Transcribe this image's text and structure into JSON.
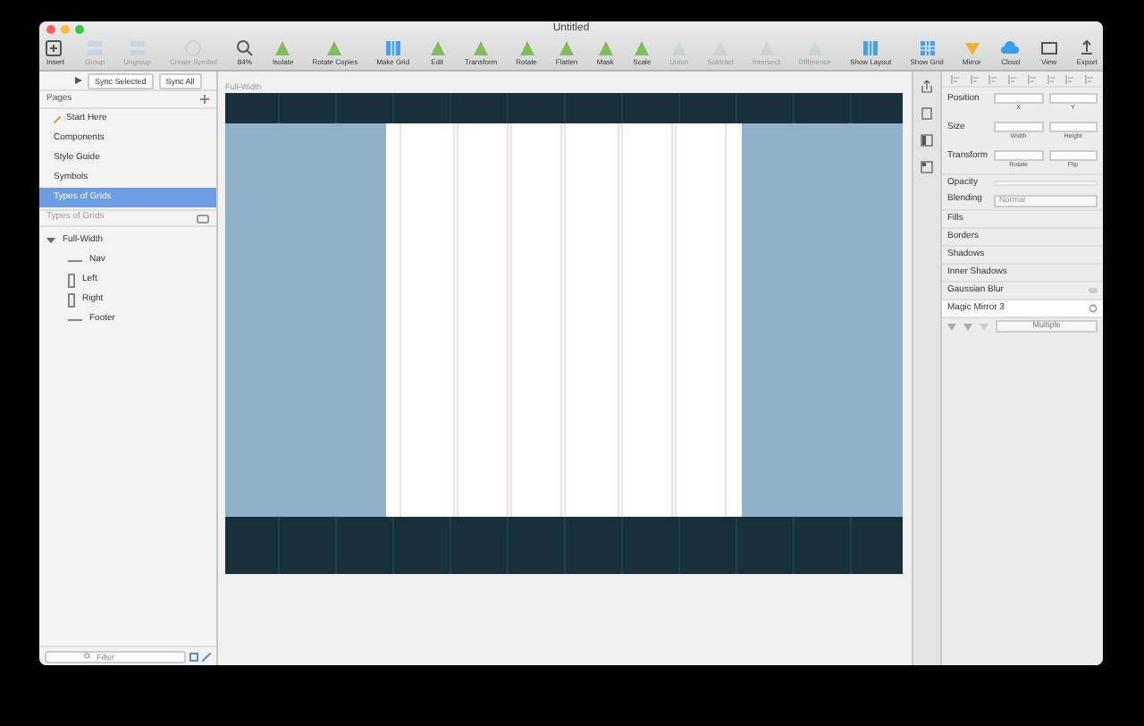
{
  "window": {
    "title": "Untitled"
  },
  "toolbar": [
    {
      "label": "Insert",
      "kind": "plus",
      "disabled": false
    },
    {
      "label": "Group",
      "kind": "group",
      "disabled": true
    },
    {
      "label": "Ungroup",
      "kind": "group",
      "disabled": true
    },
    {
      "label": "Create Symbol",
      "kind": "symbol",
      "disabled": true
    },
    {
      "label": "84%",
      "kind": "zoom",
      "disabled": false
    },
    {
      "label": "Isolate",
      "kind": "tool",
      "disabled": false
    },
    {
      "label": "Rotate Copies",
      "kind": "tool",
      "disabled": false
    },
    {
      "label": "Make Grid",
      "kind": "layout",
      "disabled": false
    },
    {
      "label": "Edit",
      "kind": "tool",
      "disabled": false
    },
    {
      "label": "Transform",
      "kind": "tool",
      "disabled": false
    },
    {
      "label": "Rotate",
      "kind": "tool",
      "disabled": false
    },
    {
      "label": "Flatten",
      "kind": "tool",
      "disabled": false
    },
    {
      "label": "Mask",
      "kind": "tool",
      "disabled": false
    },
    {
      "label": "Scale",
      "kind": "tool",
      "disabled": false
    },
    {
      "label": "Union",
      "kind": "tool",
      "disabled": true
    },
    {
      "label": "Subtract",
      "kind": "tool",
      "disabled": true
    },
    {
      "label": "Intersect",
      "kind": "tool",
      "disabled": true
    },
    {
      "label": "Difference",
      "kind": "tool",
      "disabled": true
    },
    {
      "label": "Show Layout",
      "kind": "layout",
      "disabled": false
    },
    {
      "label": "Show Grid",
      "kind": "grid",
      "disabled": false
    },
    {
      "label": "Mirror",
      "kind": "mirror",
      "disabled": false
    },
    {
      "label": "Cloud",
      "kind": "cloud",
      "disabled": false
    },
    {
      "label": "View",
      "kind": "view",
      "disabled": false
    },
    {
      "label": "Export",
      "kind": "export",
      "disabled": false
    }
  ],
  "sidebar": {
    "sync_buttons": [
      "Sync Selected",
      "Sync All"
    ],
    "pages_title": "Pages",
    "pages": [
      {
        "label": "Start Here",
        "selected": false
      },
      {
        "label": "Components",
        "selected": false
      },
      {
        "label": "Style Guide",
        "selected": false
      },
      {
        "label": "Symbols",
        "selected": false
      },
      {
        "label": "Types of Grids",
        "selected": true
      }
    ],
    "layers_title": "Types of Grids",
    "layers": [
      {
        "label": "Full-Width",
        "expanded": true,
        "children": [
          {
            "label": "Nav",
            "kind": "hline"
          },
          {
            "label": "Left",
            "kind": "vline"
          },
          {
            "label": "Right",
            "kind": "vline"
          },
          {
            "label": "Footer",
            "kind": "hline"
          }
        ]
      }
    ],
    "filter": {
      "placeholder": "Filter"
    }
  },
  "canvas": {
    "artboard_title": "Full-Width"
  },
  "inspector": {
    "position": {
      "label": "Position",
      "fields": [
        "X",
        "Y"
      ]
    },
    "size": {
      "label": "Size",
      "fields": [
        "Width",
        "Height"
      ]
    },
    "transform": {
      "label": "Transform",
      "fields": [
        "Rotate",
        "Flip"
      ]
    },
    "opacity": {
      "label": "Opacity",
      "level": 1
    },
    "blending": {
      "label": "Blending",
      "value": "Normal"
    },
    "sections": [
      {
        "label": "Fills",
        "kind": "plain"
      },
      {
        "label": "Borders",
        "kind": "plain"
      },
      {
        "label": "Shadows",
        "kind": "plain"
      },
      {
        "label": "Inner Shadows",
        "kind": "plain"
      },
      {
        "label": "Gaussian Blur",
        "kind": "toggle",
        "on": false
      },
      {
        "label": "Magic Mirror 3",
        "kind": "gear"
      }
    ],
    "perspective": {
      "value": "Multiple"
    }
  }
}
